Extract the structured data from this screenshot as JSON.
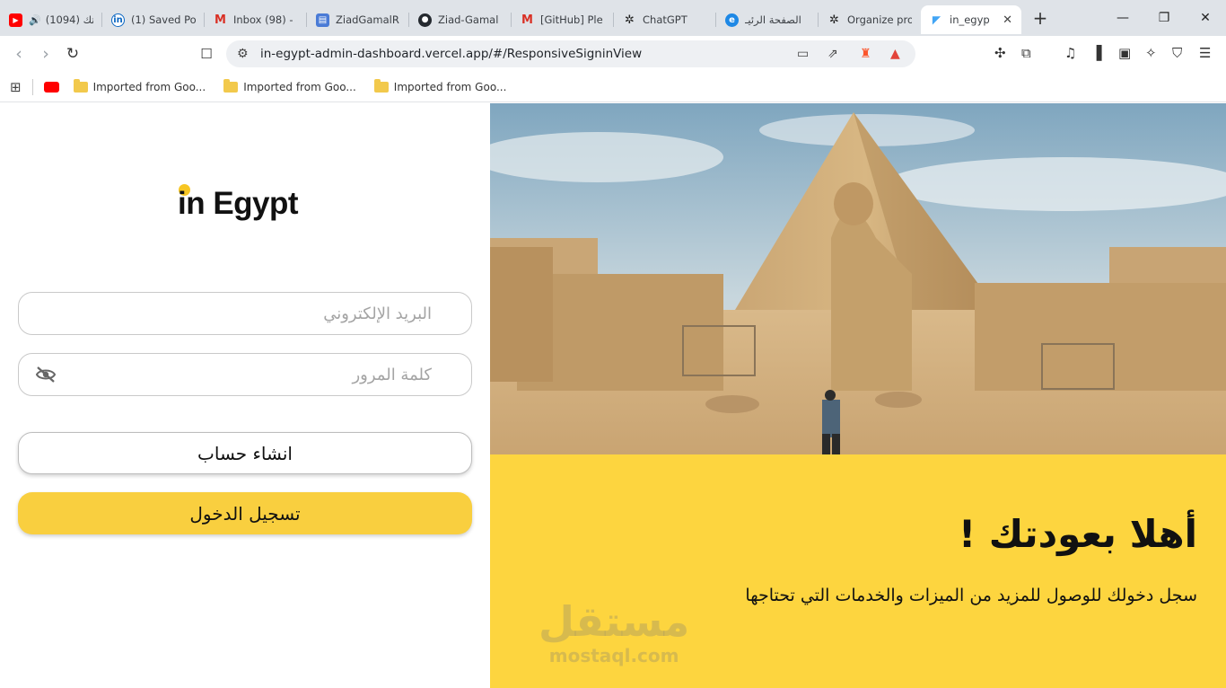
{
  "browser": {
    "tabs": [
      {
        "label": "(1094) تك",
        "icon": "youtube-icon",
        "audio": true
      },
      {
        "label": "(1) Saved Po",
        "icon": "linkedin-icon"
      },
      {
        "label": "Inbox (98) -",
        "icon": "gmail-icon"
      },
      {
        "label": "ZiadGamalR",
        "icon": "document-icon"
      },
      {
        "label": "Ziad-Gamal",
        "icon": "github-icon"
      },
      {
        "label": "[GitHub] Ple",
        "icon": "gmail-icon"
      },
      {
        "label": "ChatGPT",
        "icon": "chatgpt-icon"
      },
      {
        "label": "الصفحة الرئيـ",
        "icon": "site-icon"
      },
      {
        "label": "Organize pro",
        "icon": "chatgpt-icon"
      },
      {
        "label": "in_egyp",
        "icon": "flutter-icon",
        "active": true
      }
    ],
    "new_tab": "+",
    "url": "in-egypt-admin-dashboard.vercel.app/#/ResponsiveSigninView",
    "bookmarks": [
      {
        "label": "Imported from Goo..."
      },
      {
        "label": "Imported from Goo..."
      },
      {
        "label": "Imported from Goo..."
      }
    ]
  },
  "signin": {
    "logo_text": "in Egypt",
    "email_placeholder": "البريد الإلكتروني",
    "password_placeholder": "كلمة المرور",
    "create_account_label": "انشاء حساب",
    "login_label": "تسجيل الدخول"
  },
  "hero": {
    "welcome_title": "أهلا بعودتك !",
    "subtitle": "سجل دخولك للوصول للمزيد من الميزات والخدمات التي تحتاجها",
    "watermark_ar": "مستقل",
    "watermark_en": "mostaql.com"
  },
  "colors": {
    "accent": "#fdd53f",
    "button_primary": "#f9cf3f",
    "logo_dot": "#f7c623"
  }
}
